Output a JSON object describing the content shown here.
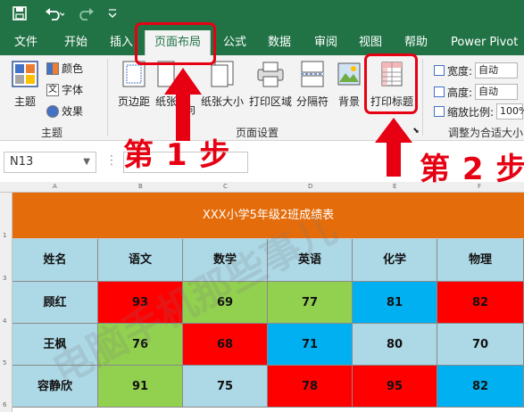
{
  "qat": {
    "save_icon": "save-icon",
    "undo_icon": "undo-icon",
    "redo_icon": "redo-icon",
    "more_icon": "chevron-down-icon"
  },
  "tabs": [
    {
      "label": "文件"
    },
    {
      "label": "开始"
    },
    {
      "label": "插入"
    },
    {
      "label": "页面布局"
    },
    {
      "label": "公式"
    },
    {
      "label": "数据"
    },
    {
      "label": "审阅"
    },
    {
      "label": "视图"
    },
    {
      "label": "帮助"
    },
    {
      "label": "Power Pivot"
    }
  ],
  "ribbon": {
    "theme": {
      "label": "主题",
      "colors": "颜色",
      "fonts": "字体",
      "effects": "效果",
      "group": "主题"
    },
    "page_setup": {
      "margins": "页边距",
      "paper": "纸张",
      "orientation": "向",
      "size": "纸张大小",
      "print_area": "打印区域",
      "breaks": "分隔符",
      "background": "背景",
      "print_titles": "打印标题",
      "group": "页面设置"
    },
    "scale": {
      "width_label": "宽度:",
      "width_value": "自动",
      "height_label": "高度:",
      "height_value": "自动",
      "scale_label": "缩放比例:",
      "scale_value": "100%",
      "group": "调整为合适大小"
    }
  },
  "annotations": {
    "step1": "第 1 步",
    "step2": "第 2 步",
    "accent_color": "#e60012"
  },
  "formula_bar": {
    "cell_ref": "N13"
  },
  "sheet": {
    "column_letters": [
      "A",
      "B",
      "C",
      "D",
      "E",
      "F"
    ],
    "row_numbers": [
      "1",
      "3",
      "4",
      "5",
      "6"
    ],
    "title": "XXX小学5年级2班成绩表",
    "headers": [
      "姓名",
      "语文",
      "数学",
      "英语",
      "化学",
      "物理"
    ],
    "rows": [
      {
        "name": "顾红",
        "scores": [
          "93",
          "69",
          "77",
          "81",
          "82"
        ]
      },
      {
        "name": "王枫",
        "scores": [
          "76",
          "68",
          "71",
          "80",
          "70"
        ]
      },
      {
        "name": "容静欣",
        "scores": [
          "91",
          "75",
          "78",
          "95",
          "82"
        ]
      }
    ],
    "colors": {
      "header_bg": "#add8e6",
      "red": "#ff0000",
      "green": "#92d050",
      "blue": "#00b0f0",
      "light": "#add8e6",
      "banner": "#e46c0a"
    }
  },
  "watermark": "电脑手机那些事儿"
}
